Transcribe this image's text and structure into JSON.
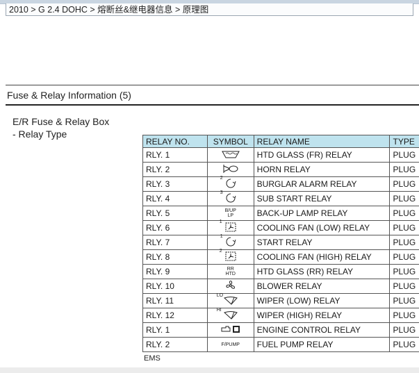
{
  "breadcrumb": "2010 > G 2.4 DOHC > 熔断丝&继电器信息 > 原理图",
  "section_title": "Fuse & Relay Information (5)",
  "subtitle": "E/R Fuse & Relay Box",
  "subtitle2": "- Relay Type",
  "table": {
    "headers": [
      "RELAY NO.",
      "SYMBOL",
      "RELAY NAME",
      "TYPE"
    ],
    "rows": [
      {
        "no": "RLY. 1",
        "symbol": "htd-glass-icon",
        "sym_text": "",
        "name": "HTD GLASS (FR) RELAY",
        "type": "PLUG"
      },
      {
        "no": "RLY. 2",
        "symbol": "horn-icon",
        "sym_text": "",
        "name": "HORN RELAY",
        "type": "PLUG"
      },
      {
        "no": "RLY. 3",
        "symbol": "relay-coil-icon",
        "sym_text": "2",
        "name": "BURGLAR ALARM RELAY",
        "type": "PLUG"
      },
      {
        "no": "RLY. 4",
        "symbol": "relay-coil-icon",
        "sym_text": "3",
        "name": "SUB START RELAY",
        "type": "PLUG"
      },
      {
        "no": "RLY. 5",
        "symbol": "text-symbol",
        "sym_text": "B/UP\nLP",
        "name": "BACK-UP LAMP RELAY",
        "type": "PLUG"
      },
      {
        "no": "RLY. 6",
        "symbol": "fan-box-icon",
        "sym_text": "1",
        "name": "COOLING FAN (LOW) RELAY",
        "type": "PLUG"
      },
      {
        "no": "RLY. 7",
        "symbol": "relay-coil-icon",
        "sym_text": "1",
        "name": "START RELAY",
        "type": "PLUG"
      },
      {
        "no": "RLY. 8",
        "symbol": "fan-box-icon",
        "sym_text": "2",
        "name": "COOLING FAN (HIGH) RELAY",
        "type": "PLUG"
      },
      {
        "no": "RLY. 9",
        "symbol": "text-symbol",
        "sym_text": "RR\nHTD",
        "name": "HTD GLASS (RR) RELAY",
        "type": "PLUG"
      },
      {
        "no": "RLY. 10",
        "symbol": "blower-icon",
        "sym_text": "",
        "name": "BLOWER RELAY",
        "type": "PLUG"
      },
      {
        "no": "RLY. 11",
        "symbol": "wiper-icon",
        "sym_text": "LO",
        "name": "WIPER (LOW) RELAY",
        "type": "PLUG"
      },
      {
        "no": "RLY. 12",
        "symbol": "wiper-icon",
        "sym_text": "HI",
        "name": "WIPER (HIGH) RELAY",
        "type": "PLUG"
      },
      {
        "no": "RLY. 1",
        "symbol": "engine-icon",
        "sym_text": "",
        "name": "ENGINE CONTROL RELAY",
        "type": "PLUG"
      },
      {
        "no": "RLY. 2",
        "symbol": "text-symbol",
        "sym_text": "F/PUMP",
        "name": "FUEL PUMP RELAY",
        "type": "PLUG"
      }
    ],
    "ems_label": "EMS"
  },
  "colors": {
    "header_bg": "#bfe3ee",
    "border": "#555555"
  }
}
